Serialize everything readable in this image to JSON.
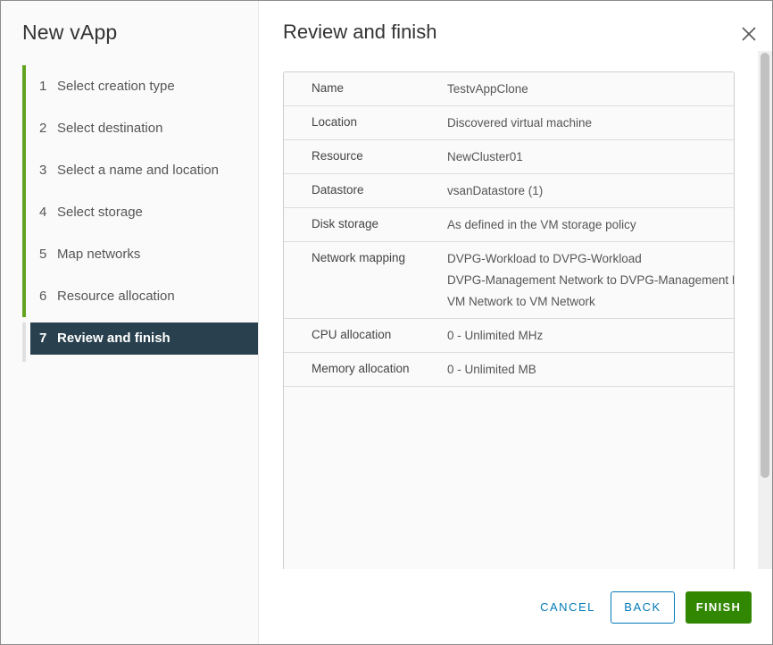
{
  "wizard": {
    "title": "New vApp",
    "steps": [
      {
        "num": "1",
        "label": "Select creation type"
      },
      {
        "num": "2",
        "label": "Select destination"
      },
      {
        "num": "3",
        "label": "Select a name and location"
      },
      {
        "num": "4",
        "label": "Select storage"
      },
      {
        "num": "5",
        "label": "Map networks"
      },
      {
        "num": "6",
        "label": "Resource allocation"
      },
      {
        "num": "7",
        "label": "Review and finish"
      }
    ],
    "active_step": 7
  },
  "main": {
    "title": "Review and finish",
    "close_icon": "close-icon",
    "rows": [
      {
        "key": "Name",
        "values": [
          "TestvAppClone"
        ]
      },
      {
        "key": "Location",
        "values": [
          "Discovered virtual machine"
        ]
      },
      {
        "key": "Resource",
        "values": [
          "NewCluster01"
        ]
      },
      {
        "key": "Datastore",
        "values": [
          "vsanDatastore (1)"
        ]
      },
      {
        "key": "Disk storage",
        "values": [
          "As defined in the VM storage policy"
        ]
      },
      {
        "key": "Network mapping",
        "values": [
          "DVPG-Workload to DVPG-Workload",
          "DVPG-Management Network to DVPG-Management Network",
          "VM Network to VM Network"
        ]
      },
      {
        "key": "CPU allocation",
        "values": [
          "0 - Unlimited MHz"
        ]
      },
      {
        "key": "Memory allocation",
        "values": [
          "0 - Unlimited MB"
        ]
      }
    ]
  },
  "footer": {
    "cancel_label": "CANCEL",
    "back_label": "BACK",
    "finish_label": "FINISH"
  },
  "colors": {
    "step_progress": "#62a420",
    "active_step_bg": "#29414e",
    "link_blue": "#0079b8",
    "finish_green": "#318700"
  }
}
